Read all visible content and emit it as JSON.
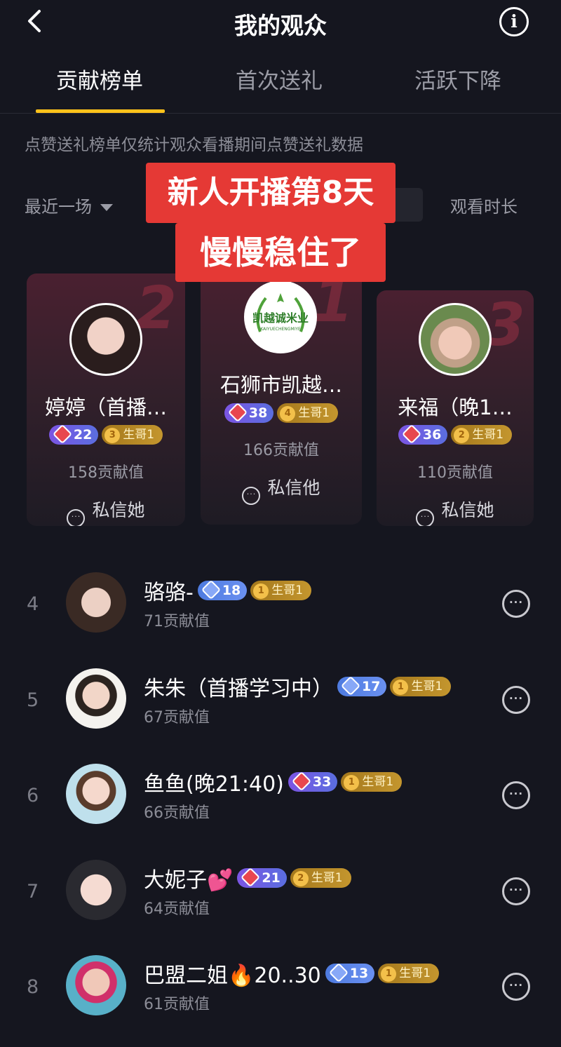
{
  "header": {
    "title": "我的观众",
    "info_icon_glyph": "i"
  },
  "tabs": [
    {
      "label": "贡献榜单",
      "active": true
    },
    {
      "label": "首次送礼",
      "active": false
    },
    {
      "label": "活跃下降",
      "active": false
    }
  ],
  "notice": "点赞送礼榜单仅统计观众看播期间点赞送礼数据",
  "filters": {
    "period": "最近一场",
    "sort": "观看时长"
  },
  "overlay": {
    "line1": "新人开播第8天",
    "line2": "慢慢稳住了"
  },
  "podium": [
    {
      "rank": "2",
      "name": "婷婷（首播…",
      "level": "22",
      "fan_level": "3",
      "fan_label": "生哥1",
      "value": "158贡献值",
      "action": "私信她"
    },
    {
      "rank": "1",
      "name": "石狮市凯越…",
      "level": "38",
      "fan_level": "4",
      "fan_label": "生哥1",
      "value": "166贡献值",
      "action": "私信他",
      "logo_text": "凯越诚米业",
      "logo_sub": "KAIYUECHENGMIYE"
    },
    {
      "rank": "3",
      "name": "来福（晚1…",
      "level": "36",
      "fan_level": "2",
      "fan_label": "生哥1",
      "value": "110贡献值",
      "action": "私信她"
    }
  ],
  "list": [
    {
      "rank": "4",
      "name": "骆骆-",
      "level": "18",
      "fan_level": "1",
      "fan_label": "生哥1",
      "value": "71贡献值"
    },
    {
      "rank": "5",
      "name": "朱朱（首播学习中）",
      "level": "17",
      "fan_level": "1",
      "fan_label": "生哥1",
      "value": "67贡献值"
    },
    {
      "rank": "6",
      "name": "鱼鱼(晚21:40)",
      "level": "33",
      "fan_level": "1",
      "fan_label": "生哥1",
      "value": "66贡献值"
    },
    {
      "rank": "7",
      "name": "大妮子💕",
      "level": "21",
      "fan_level": "2",
      "fan_label": "生哥1",
      "value": "64贡献值"
    },
    {
      "rank": "8",
      "name": "巴盟二姐🔥20..30",
      "level": "13",
      "fan_level": "1",
      "fan_label": "生哥1",
      "value": "61贡献值"
    }
  ],
  "colors": {
    "accent": "#ffc21a",
    "background": "#15161f",
    "overlay_red": "#e53935"
  }
}
